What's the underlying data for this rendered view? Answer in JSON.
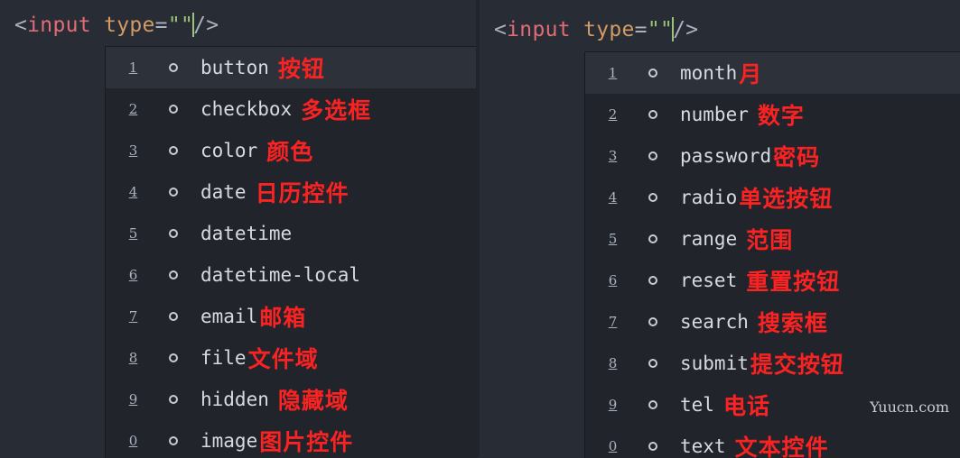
{
  "colors": {
    "bg": "#282c34",
    "popup_bg": "#21252b",
    "annotation": "#ff2222",
    "tag": "#e06c75",
    "attr": "#d19a66",
    "string": "#98c379"
  },
  "left": {
    "code": {
      "open": "<",
      "tag": "input",
      "attr": "type",
      "eq": "=",
      "q1": "\"",
      "q2": "\"",
      "close": "/>"
    },
    "items": [
      {
        "num": "1",
        "label": "button",
        "anno": "按钮"
      },
      {
        "num": "2",
        "label": "checkbox",
        "anno": "多选框"
      },
      {
        "num": "3",
        "label": "color",
        "anno": "颜色"
      },
      {
        "num": "4",
        "label": "date",
        "anno": "日历控件"
      },
      {
        "num": "5",
        "label": "datetime",
        "anno": ""
      },
      {
        "num": "6",
        "label": "datetime-local",
        "anno": ""
      },
      {
        "num": "7",
        "label": "email",
        "anno": "邮箱"
      },
      {
        "num": "8",
        "label": "file",
        "anno": "文件域"
      },
      {
        "num": "9",
        "label": "hidden",
        "anno": "隐藏域"
      },
      {
        "num": "0",
        "label": "image",
        "anno": "图片控件"
      }
    ]
  },
  "right": {
    "code": {
      "open": "<",
      "tag": "input",
      "attr": "type",
      "eq": "=",
      "q1": "\"",
      "q2": "\"",
      "close": "/>"
    },
    "items": [
      {
        "num": "1",
        "label": "month",
        "anno": "月"
      },
      {
        "num": "2",
        "label": "number",
        "anno": "数字"
      },
      {
        "num": "3",
        "label": "password",
        "anno": "密码"
      },
      {
        "num": "4",
        "label": "radio",
        "anno": "单选按钮"
      },
      {
        "num": "5",
        "label": "range",
        "anno": "范围"
      },
      {
        "num": "6",
        "label": "reset",
        "anno": "重置按钮"
      },
      {
        "num": "7",
        "label": "search",
        "anno": "搜索框"
      },
      {
        "num": "8",
        "label": "submit",
        "anno": "提交按钮"
      },
      {
        "num": "9",
        "label": "tel",
        "anno": "电话"
      },
      {
        "num": "0",
        "label": "text",
        "anno": "文本控件"
      }
    ]
  },
  "watermark": "Yuucn.com"
}
